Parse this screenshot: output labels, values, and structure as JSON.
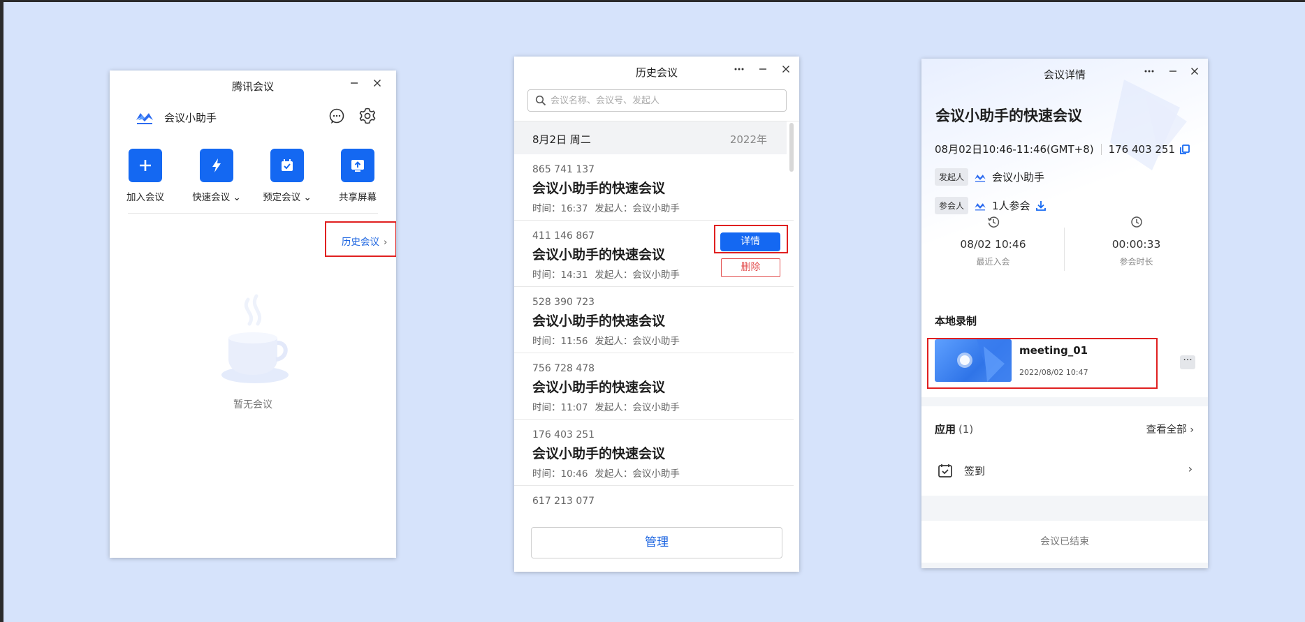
{
  "window_main": {
    "title": "腾讯会议",
    "user_name": "会议小助手",
    "actions": [
      {
        "label": "加入会议",
        "icon": "plus-icon"
      },
      {
        "label": "快速会议",
        "icon": "lightning-icon"
      },
      {
        "label": "预定会议",
        "icon": "calendar-check-icon"
      },
      {
        "label": "共享屏幕",
        "icon": "share-screen-icon"
      }
    ],
    "history_link": "历史会议",
    "empty_text": "暂无会议"
  },
  "window_history": {
    "title": "历史会议",
    "search_placeholder": "会议名称、会议号、发起人",
    "date_label": "8月2日 周二",
    "year_label": "2022年",
    "meetings": [
      {
        "id": "865 741 137",
        "name": "会议小助手的快速会议",
        "time": "时间：16:37",
        "host": "发起人：会议小助手"
      },
      {
        "id": "411 146 867",
        "name": "会议小助手的快速会议",
        "time": "时间：14:31",
        "host": "发起人：会议小助手"
      },
      {
        "id": "528 390 723",
        "name": "会议小助手的快速会议",
        "time": "时间：11:56",
        "host": "发起人：会议小助手"
      },
      {
        "id": "756 728 478",
        "name": "会议小助手的快速会议",
        "time": "时间：11:07",
        "host": "发起人：会议小助手"
      },
      {
        "id": "176 403 251",
        "name": "会议小助手的快速会议",
        "time": "时间：10:46",
        "host": "发起人：会议小助手"
      },
      {
        "id": "617 213 077",
        "name": "",
        "time": "",
        "host": ""
      }
    ],
    "detail_button": "详情",
    "delete_button": "删除",
    "manage_button": "管理"
  },
  "window_detail": {
    "title": "会议详情",
    "meeting_name": "会议小助手的快速会议",
    "time_range": "08月02日10:46-11:46(GMT+8)",
    "meeting_id": "176 403 251",
    "host_tag": "发起人",
    "host_name": "会议小助手",
    "participants_tag": "参会人",
    "participants_count": "1人参会",
    "last_join_value": "08/02 10:46",
    "last_join_label": "最近入会",
    "duration_value": "00:00:33",
    "duration_label": "参会时长",
    "local_recording_title": "本地录制",
    "recording_name": "meeting_01",
    "recording_date": "2022/08/02 10:47",
    "apps_title": "应用",
    "apps_count": "(1)",
    "view_all": "查看全部",
    "signin_label": "签到",
    "ended_text": "会议已结束"
  },
  "colors": {
    "accent": "#1468f2",
    "highlight_box": "#e02020",
    "background": "#d6e3fb"
  }
}
